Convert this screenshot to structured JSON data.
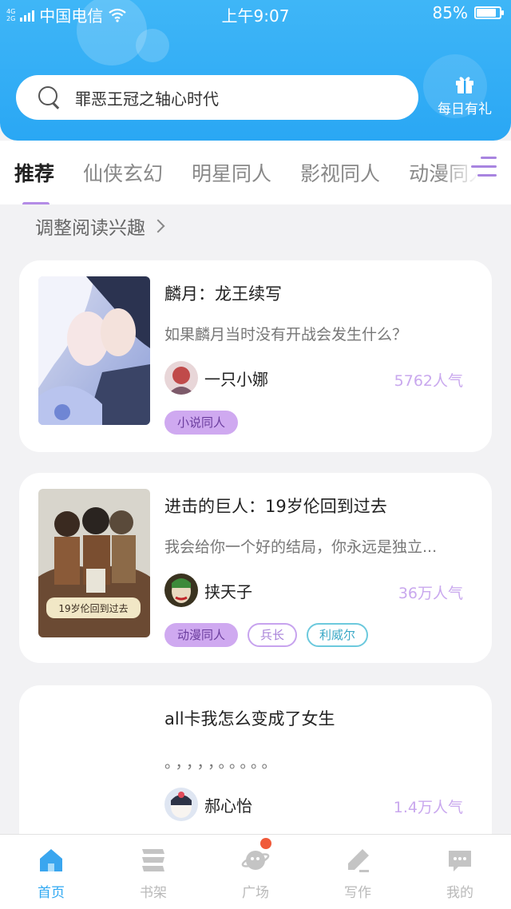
{
  "status_bar": {
    "network_tag": "4G 2G",
    "carrier": "中国电信",
    "time": "上午9:07",
    "battery": "85%",
    "battery_level": 0.85
  },
  "search": {
    "text": "罪恶王冠之轴心时代"
  },
  "daily_gift": {
    "label": "每日有礼"
  },
  "tabs": [
    {
      "label": "推荐",
      "active": true
    },
    {
      "label": "仙侠玄幻",
      "active": false
    },
    {
      "label": "明星同人",
      "active": false
    },
    {
      "label": "影视同人",
      "active": false
    },
    {
      "label": "动漫同人",
      "active": false
    }
  ],
  "interest_link": "调整阅读兴趣",
  "stories": [
    {
      "title": "麟月：龙王续写",
      "description": "如果麟月当时没有开战会发生什么？",
      "author": "一只小娜",
      "popularity": "5762人气",
      "tags": [
        "小说同人"
      ]
    },
    {
      "title": "进击的巨人：19岁伦回到过去",
      "description": "我会给你一个好的结局，你永远是独立...",
      "author": "挟天子",
      "popularity": "36万人气",
      "cover_caption": "19岁伦回到过去",
      "tags": [
        "动漫同人",
        "兵长",
        "利威尔"
      ]
    },
    {
      "title": "all卡我怎么变成了女生",
      "description": "。，，，，。。。。。",
      "author": "郝心怡",
      "popularity": "1.4万人气",
      "tags": []
    }
  ],
  "bottom_nav": [
    {
      "label": "首页",
      "icon": "home-icon",
      "active": true
    },
    {
      "label": "书架",
      "icon": "bookshelf-icon",
      "active": false
    },
    {
      "label": "广场",
      "icon": "planet-icon",
      "active": false,
      "badge": true
    },
    {
      "label": "写作",
      "icon": "pen-icon",
      "active": false
    },
    {
      "label": "我的",
      "icon": "chat-bubble-icon",
      "active": false
    }
  ],
  "colors": {
    "header_blue": "#2aa7f4",
    "accent_purple": "#b48ce6",
    "popularity_purple": "#c9a8ee",
    "nav_active": "#2ea8f2",
    "badge_red": "#f05a3a"
  }
}
